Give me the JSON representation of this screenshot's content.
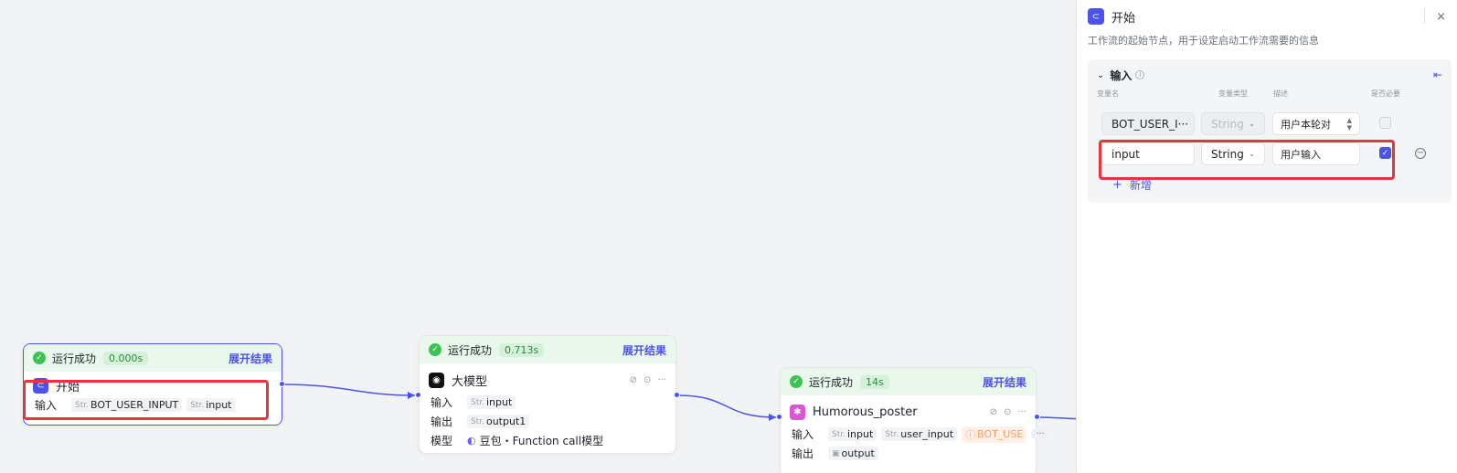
{
  "colors": {
    "accent": "#4d53e8",
    "success": "#3ec254",
    "highlight": "#e5343f",
    "warning": "#ff9a5c"
  },
  "nodes": {
    "start": {
      "status": "运行成功",
      "time": "0.000s",
      "expand": "展开结果",
      "icon": "start-icon",
      "title": "开始",
      "input_label": "输入",
      "inputs": [
        {
          "type": "Str.",
          "name": "BOT_USER_INPUT"
        },
        {
          "type": "Str.",
          "name": "input"
        }
      ]
    },
    "llm": {
      "status": "运行成功",
      "time": "0.713s",
      "expand": "展开结果",
      "icon": "llm-icon",
      "title": "大模型",
      "input_label": "输入",
      "output_label": "输出",
      "model_label": "模型",
      "inputs": [
        {
          "type": "Str.",
          "name": "input"
        }
      ],
      "outputs": [
        {
          "type": "Str.",
          "name": "output1"
        }
      ],
      "model": "豆包・Function call模型"
    },
    "poster": {
      "status": "运行成功",
      "time": "14s",
      "expand": "展开结果",
      "icon": "plugin-icon",
      "title": "Humorous_poster",
      "input_label": "输入",
      "output_label": "输出",
      "inputs": [
        {
          "type": "Str.",
          "name": "input"
        },
        {
          "type": "Str.",
          "name": "user_input"
        }
      ],
      "warning_chip": "BOT_USE",
      "outputs": [
        {
          "type": "img",
          "name": "output"
        }
      ],
      "more": "···"
    }
  },
  "panel": {
    "title": "开始",
    "description": "工作流的起始节点，用于设定启动工作流需要的信息",
    "close": "×",
    "section": {
      "title": "输入",
      "columns": {
        "name": "变量名",
        "type": "变量类型",
        "desc": "描述",
        "required": "是否必要"
      },
      "rows": [
        {
          "name": "BOT_USER_I···",
          "type": "String",
          "desc": "用户本轮对",
          "required": false
        },
        {
          "name": "input",
          "type": "String",
          "desc": "用户输入",
          "required": true
        }
      ],
      "add_label": "新增"
    }
  }
}
